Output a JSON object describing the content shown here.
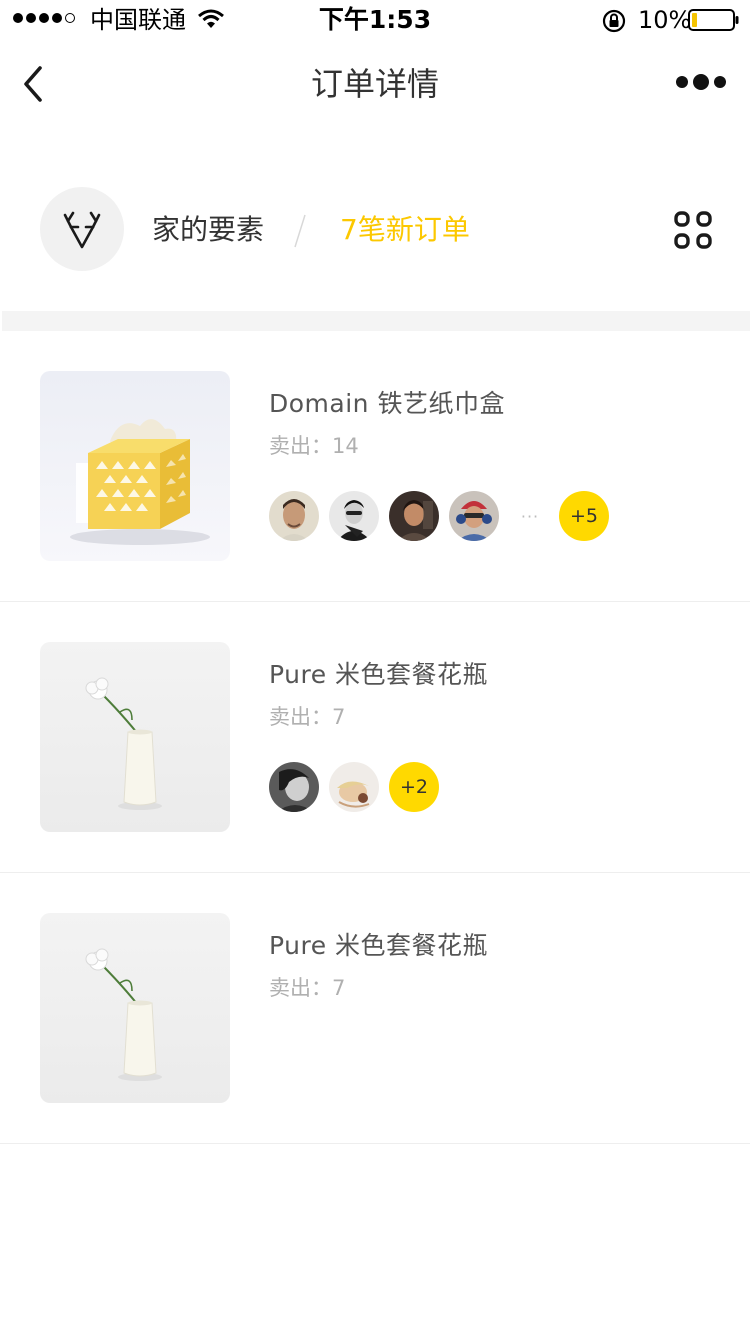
{
  "status_bar": {
    "carrier": "中国联通",
    "time": "下午1:53",
    "battery": "10%"
  },
  "nav": {
    "title": "订单详情"
  },
  "shop": {
    "name": "家的要素",
    "new_orders": "7笔新订单"
  },
  "colors": {
    "accent": "#fcc800",
    "badge": "#ffd900",
    "gap": "#f4f4f4"
  },
  "icons": [
    "back-icon",
    "more-icon",
    "deer-logo-icon",
    "grid-icon",
    "wifi-icon",
    "lock-rotation-icon",
    "battery-icon"
  ],
  "products": [
    {
      "title": "Domain 铁艺纸巾盒",
      "sold_label": "卖出：14",
      "buyers_more": "+5",
      "ellipsis": "···"
    },
    {
      "title": "Pure 米色套餐花瓶",
      "sold_label": "卖出：7",
      "buyers_more": "+2"
    },
    {
      "title": "Pure 米色套餐花瓶",
      "sold_label": "卖出：7"
    }
  ]
}
